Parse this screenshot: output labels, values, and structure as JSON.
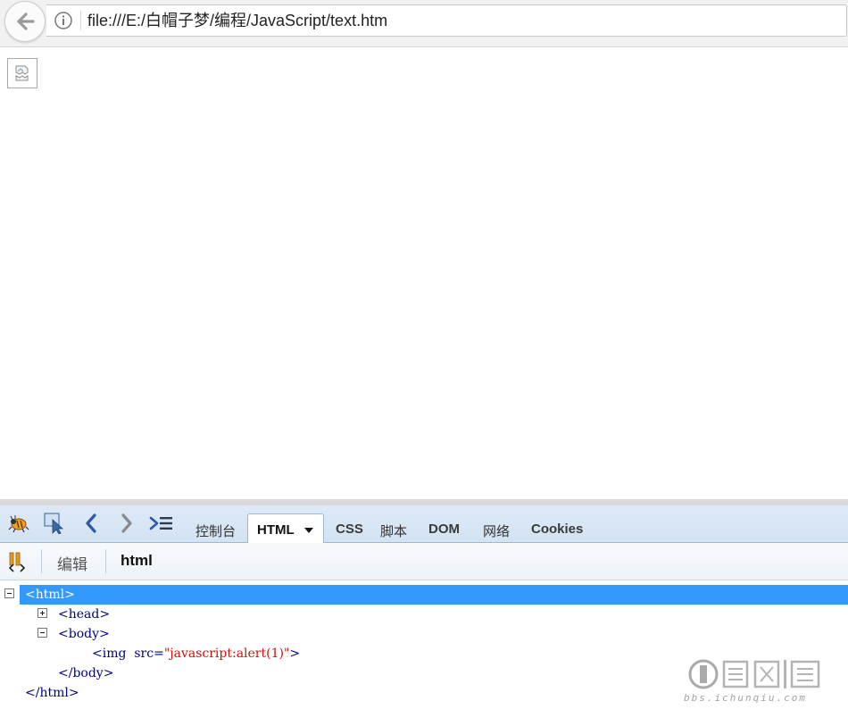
{
  "browser": {
    "url": "file:///E:/白帽子梦/编程/JavaScript/text.htm"
  },
  "page": {
    "content": [
      {
        "type": "broken-image",
        "icon": "broken-image-icon"
      }
    ]
  },
  "firebug": {
    "tabs": [
      {
        "label": "控制台"
      },
      {
        "label": "HTML",
        "active": true
      },
      {
        "label": "CSS"
      },
      {
        "label": "脚本"
      },
      {
        "label": "DOM"
      },
      {
        "label": "网络"
      },
      {
        "label": "Cookies"
      }
    ],
    "toolbar": {
      "edit_label": "编辑",
      "breadcrumb": "html"
    },
    "tree": {
      "html_open": "<html>",
      "head": "<head>",
      "body_open": "<body>",
      "img_tag": "<img",
      "img_attr_name": "src=",
      "img_attr_value": "\"javascript:alert(1)\"",
      "img_close": ">",
      "body_close": "</body>",
      "html_close": "</html>"
    },
    "colors": {
      "selection": "#3399ff",
      "tag": "#000088",
      "attr_value": "#cc1111"
    }
  },
  "watermark": {
    "url_text": "bbs.ichunqiu.com"
  }
}
